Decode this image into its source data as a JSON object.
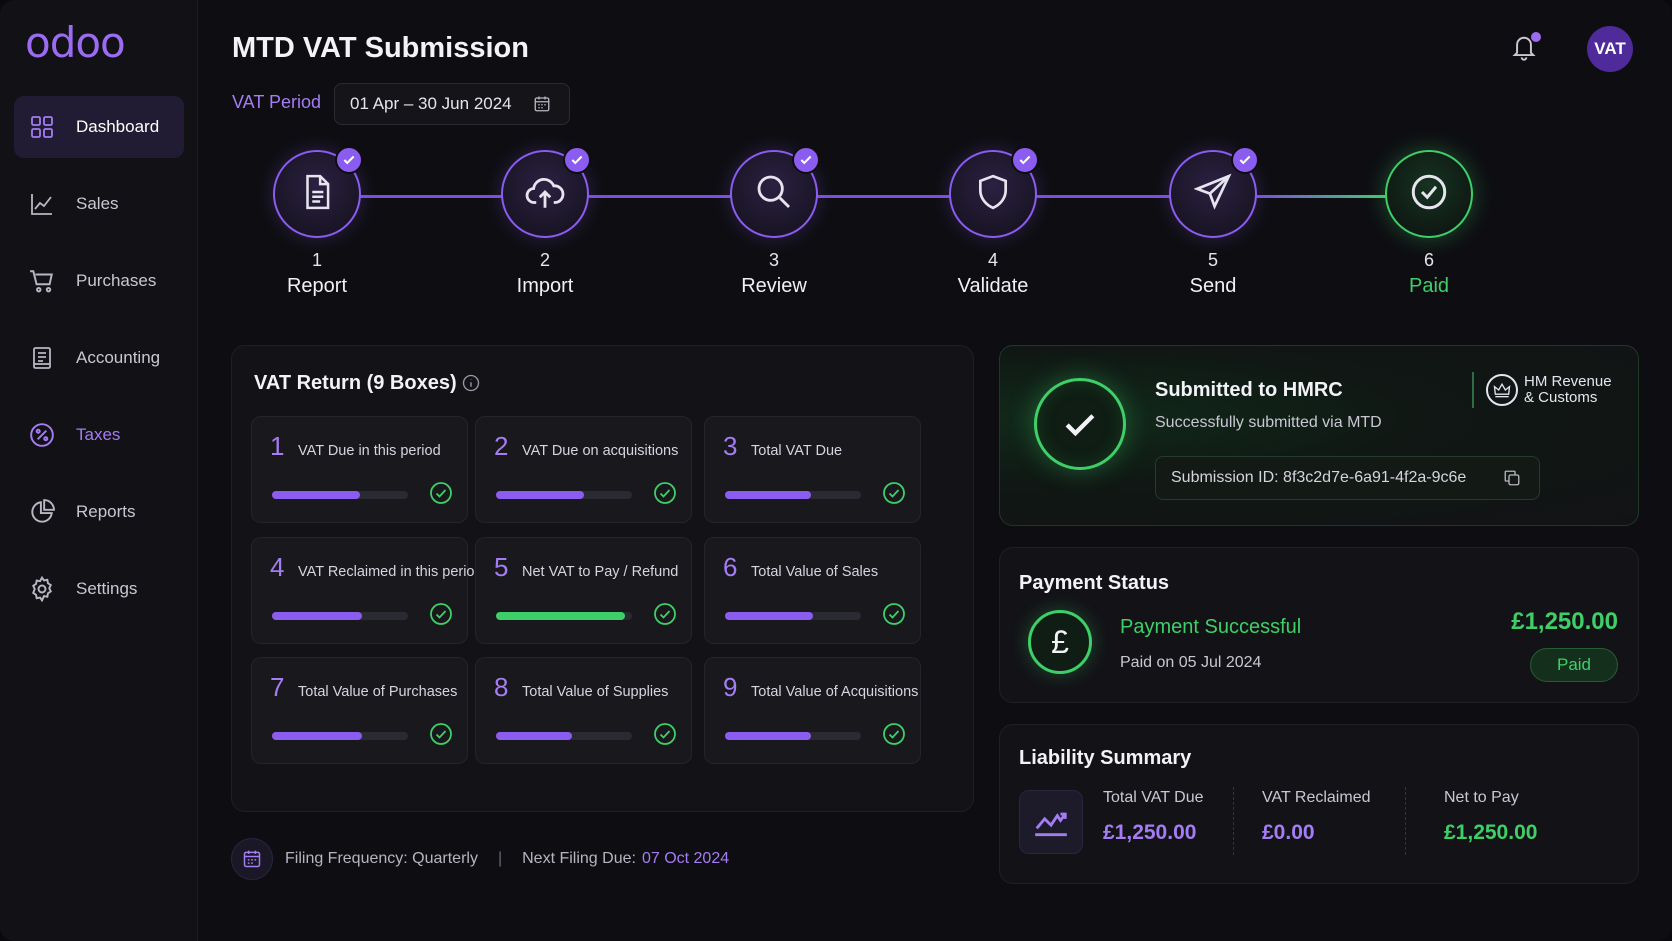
{
  "app": {
    "logo": "odoo",
    "title": "MTD VAT Submission"
  },
  "sidebar": {
    "items": [
      {
        "label": "Dashboard",
        "icon": "grid-icon"
      },
      {
        "label": "Sales",
        "icon": "trend-icon"
      },
      {
        "label": "Purchases",
        "icon": "cart-icon"
      },
      {
        "label": "Accounting",
        "icon": "ledger-icon"
      },
      {
        "label": "Taxes",
        "icon": "percent-icon"
      },
      {
        "label": "Reports",
        "icon": "pie-chart-icon"
      },
      {
        "label": "Settings",
        "icon": "gear-icon"
      }
    ]
  },
  "header": {
    "period_label": "VAT Period",
    "period_value": "01 Apr – 30 Jun 2024",
    "avatar": "VAT"
  },
  "steps": [
    {
      "num": "1",
      "name": "Report",
      "icon": "document-icon",
      "done": true
    },
    {
      "num": "2",
      "name": "Import",
      "icon": "cloud-upload-icon",
      "done": true
    },
    {
      "num": "3",
      "name": "Review",
      "icon": "search-icon",
      "done": true
    },
    {
      "num": "4",
      "name": "Validate",
      "icon": "shield-icon",
      "done": true
    },
    {
      "num": "5",
      "name": "Send",
      "icon": "paper-plane-icon",
      "done": true
    },
    {
      "num": "6",
      "name": "Paid",
      "icon": "check-circle-icon",
      "done": false
    }
  ],
  "vat_return": {
    "title": "VAT Return (9 Boxes)",
    "boxes": [
      {
        "num": "1",
        "label": "VAT Due in this period",
        "progress": 0.65
      },
      {
        "num": "2",
        "label": "VAT Due on acquisitions",
        "progress": 0.65
      },
      {
        "num": "3",
        "label": "Total VAT Due",
        "progress": 0.63
      },
      {
        "num": "4",
        "label": "VAT Reclaimed in this period",
        "progress": 0.66
      },
      {
        "num": "5",
        "label": "Net VAT to Pay / Refund",
        "progress": 0.95
      },
      {
        "num": "6",
        "label": "Total Value of Sales",
        "progress": 0.65
      },
      {
        "num": "7",
        "label": "Total Value of Purchases",
        "progress": 0.66
      },
      {
        "num": "8",
        "label": "Total Value of Supplies",
        "progress": 0.56
      },
      {
        "num": "9",
        "label": "Total Value of Acquisitions",
        "progress": 0.63
      }
    ]
  },
  "footer": {
    "frequency": "Filing Frequency: Quarterly",
    "separator": "|",
    "next_label": "Next Filing Due:",
    "next_value": "07 Oct 2024"
  },
  "hmrc": {
    "title": "Submitted to HMRC",
    "subtitle": "Successfully submitted via MTD",
    "logo_line1": "HM Revenue",
    "logo_line2": "& Customs",
    "submission_id": "Submission ID:  8f3c2d7e-6a91-4f2a-9c6e"
  },
  "payment": {
    "title": "Payment Status",
    "status": "Payment Successful",
    "date": "Paid on 05 Jul 2024",
    "amount": "£1,250.00",
    "pill": "Paid",
    "symbol": "£"
  },
  "liability": {
    "title": "Liability Summary",
    "cols": [
      {
        "label": "Total VAT Due",
        "value": "£1,250.00"
      },
      {
        "label": "VAT Reclaimed",
        "value": "£0.00"
      },
      {
        "label": "Net to Pay",
        "value": "£1,250.00"
      }
    ]
  },
  "colors": {
    "accent": "#8b5cf0",
    "success": "#3fcf68",
    "bg": "#0e0e12"
  }
}
